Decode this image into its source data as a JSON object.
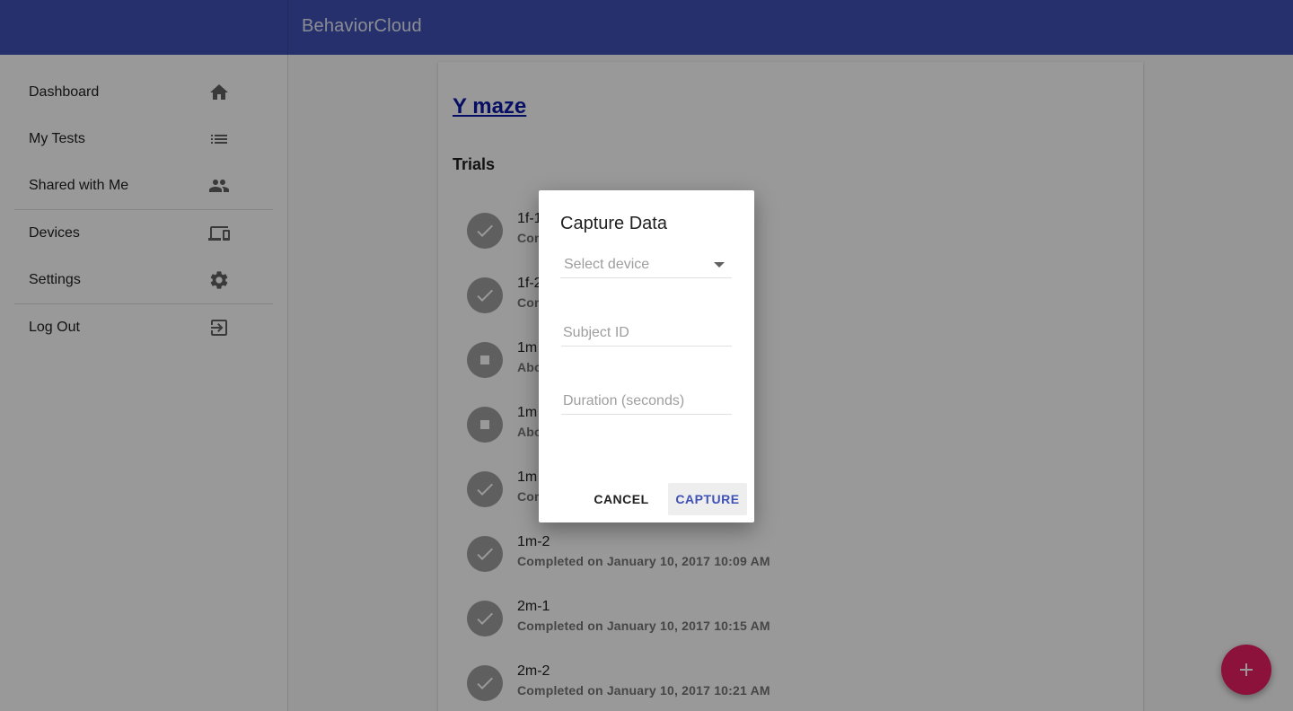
{
  "app": {
    "title": "BehaviorCloud"
  },
  "sidebar": {
    "items": [
      {
        "label": "Dashboard",
        "icon": "home-icon"
      },
      {
        "label": "My Tests",
        "icon": "list-icon"
      },
      {
        "label": "Shared with Me",
        "icon": "people-icon"
      },
      {
        "label": "Devices",
        "icon": "devices-icon"
      },
      {
        "label": "Settings",
        "icon": "gear-icon"
      },
      {
        "label": "Log Out",
        "icon": "logout-icon"
      }
    ]
  },
  "test": {
    "title": "Y maze",
    "section": "Trials",
    "trials": [
      {
        "name": "1f-1",
        "status": "Completed on",
        "state": "completed"
      },
      {
        "name": "1f-2",
        "status": "Completed on",
        "state": "completed"
      },
      {
        "name": "1m",
        "status": "Abo",
        "state": "aborted"
      },
      {
        "name": "1m",
        "status": "Abo",
        "state": "aborted"
      },
      {
        "name": "1m",
        "status": "Completed on",
        "state": "completed"
      },
      {
        "name": "1m-2",
        "status": "Completed on January 10, 2017 10:09 AM",
        "state": "completed"
      },
      {
        "name": "2m-1",
        "status": "Completed on January 10, 2017 10:15 AM",
        "state": "completed"
      },
      {
        "name": "2m-2",
        "status": "Completed on January 10, 2017 10:21 AM",
        "state": "completed"
      }
    ]
  },
  "dialog": {
    "title": "Capture Data",
    "device_placeholder": "Select device",
    "subject_placeholder": "Subject ID",
    "duration_placeholder": "Duration (seconds)",
    "cancel_label": "CANCEL",
    "capture_label": "CAPTURE"
  },
  "fab": {
    "icon": "plus-icon"
  },
  "colors": {
    "primary": "#3f51b5",
    "accent": "#e91e63",
    "link": "#0d1aa8"
  }
}
